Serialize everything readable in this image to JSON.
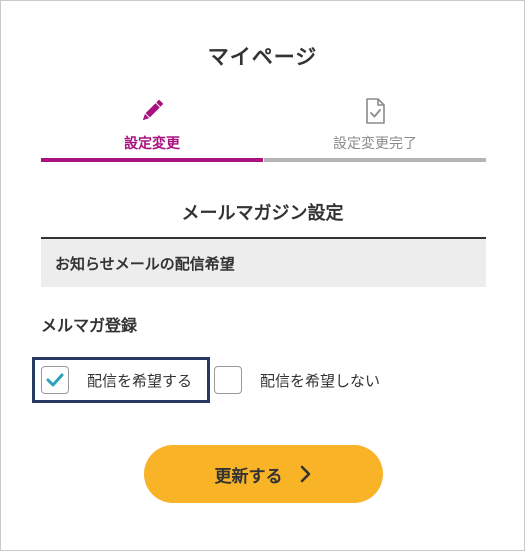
{
  "page": {
    "title": "マイページ"
  },
  "steps": [
    {
      "label": "設定変更",
      "icon": "pencil-icon",
      "active": true
    },
    {
      "label": "設定変更完了",
      "icon": "document-check-icon",
      "active": false
    }
  ],
  "section": {
    "title": "メールマガジン設定",
    "notice": "お知らせメールの配信希望"
  },
  "mailmag": {
    "label": "メルマガ登録",
    "options": [
      {
        "label": "配信を希望する",
        "checked": true
      },
      {
        "label": "配信を希望しない",
        "checked": false
      }
    ]
  },
  "submit": {
    "label": "更新する",
    "icon": "chevron-right-icon"
  },
  "colors": {
    "accent": "#a8127f",
    "inactive": "#b5b5b5",
    "button": "#f8b426",
    "check": "#2aa3b8",
    "focus_border": "#253a5e"
  }
}
